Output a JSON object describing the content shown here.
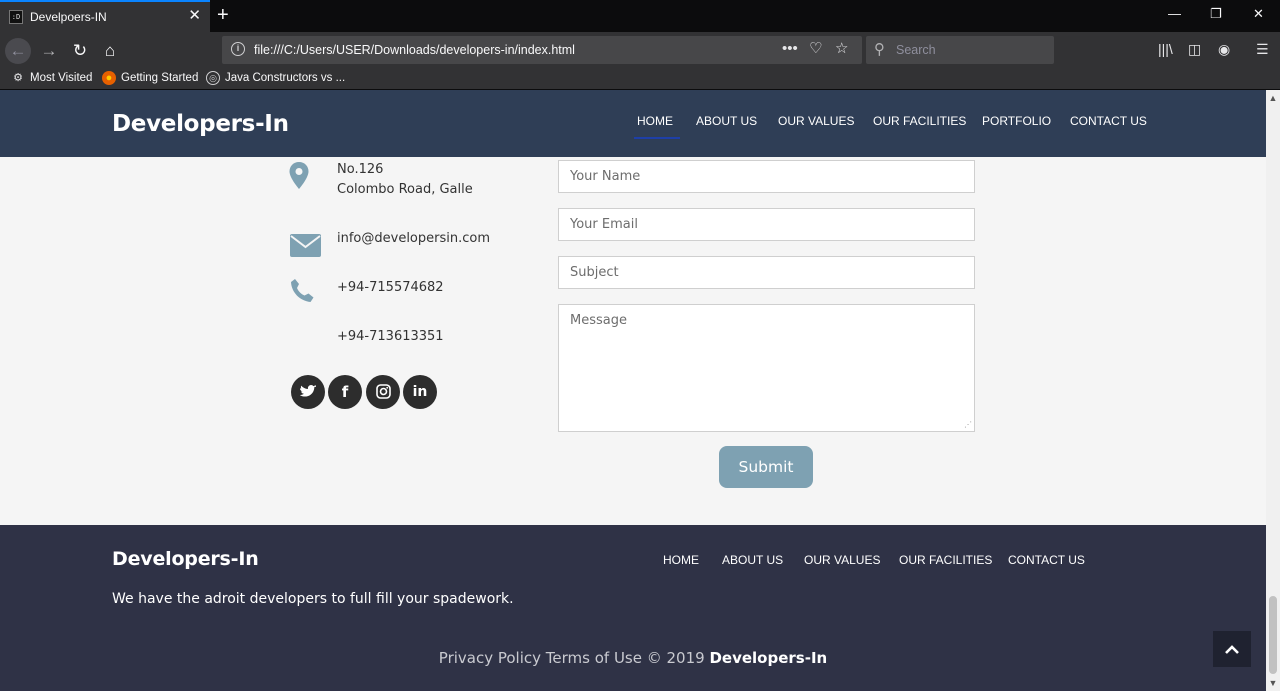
{
  "browser": {
    "tab_title": "Develpoers-IN",
    "url": "file:///C:/Users/USER/Downloads/developers-in/index.html",
    "search_placeholder": "Search",
    "bookmarks": [
      "Most Visited",
      "Getting Started",
      "Java Constructors vs ..."
    ]
  },
  "header": {
    "brand": "Developers-In",
    "menu": [
      "HOME",
      "ABOUT US",
      "OUR VALUES",
      "OUR FACILITIES",
      "PORTFOLIO",
      "CONTACT US"
    ],
    "active": "HOME"
  },
  "contact": {
    "address_line1": "No.126",
    "address_line2": "Colombo Road, Galle",
    "email": "info@developersin.com",
    "phone1": "+94-715574682",
    "phone2": "+94-713613351",
    "social": [
      "twitter",
      "facebook",
      "instagram",
      "linkedin"
    ]
  },
  "form": {
    "name_placeholder": "Your Name",
    "email_placeholder": "Your Email",
    "subject_placeholder": "Subject",
    "message_placeholder": "Message",
    "submit_label": "Submit"
  },
  "footer": {
    "brand": "Developers-In",
    "menu": [
      "HOME",
      "ABOUT US",
      "OUR VALUES",
      "OUR FACILITIES",
      "CONTACT US"
    ],
    "tagline": "We have the adroit developers to full fill your spadework.",
    "copyright_prefix": "Privacy Policy Terms of Use © 2019",
    "copyright_brand": "Developers-In"
  },
  "colors": {
    "header_bg": "#2f3e56",
    "footer_bg": "#2f3246",
    "accent": "#7ea1b2",
    "active_underline": "#1e3fa8"
  }
}
